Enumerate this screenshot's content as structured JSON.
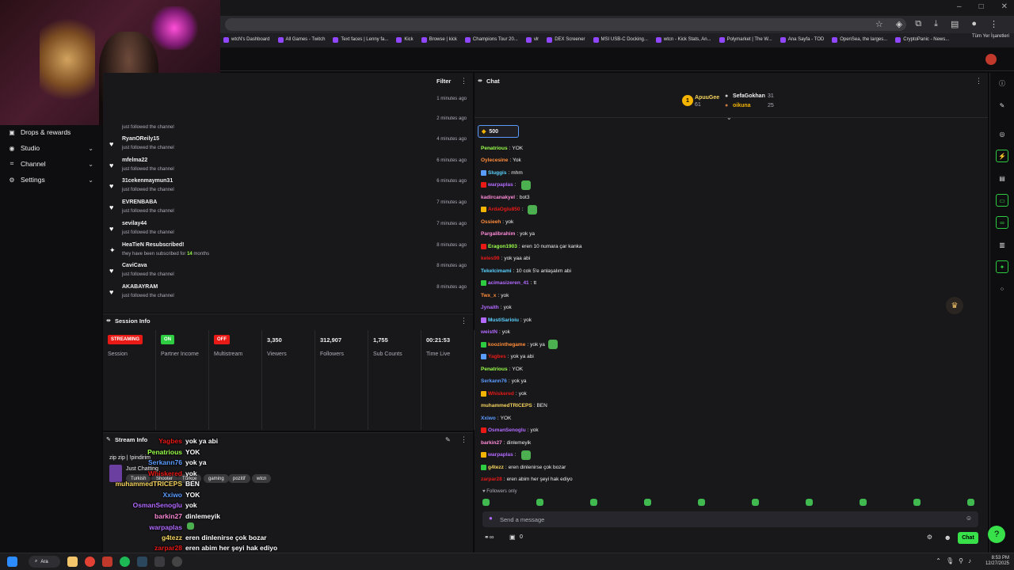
{
  "browser": {
    "bookmarks": [
      "wtcN's Dashboard",
      "All Games - Twitch",
      "Text faces | Lenny fa...",
      "Kick",
      "Browse | kick",
      "Champions Tour 20...",
      "vlr",
      "DEX Screener",
      "MSI USB-C Docking...",
      "wtcn - Kick Stats, An...",
      "Polymarket | The W...",
      "Ana Sayfa - TOD",
      "OpenSea, the larges...",
      "CryptoPanic - News..."
    ],
    "other_bookmarks": "Tüm Yer İşaretleri"
  },
  "sidebar": {
    "items": [
      {
        "label": "Drops & rewards",
        "icon": "gift-icon"
      },
      {
        "label": "Studio",
        "icon": "studio-icon"
      },
      {
        "label": "Channel",
        "icon": "channel-icon"
      },
      {
        "label": "Settings",
        "icon": "gear-icon"
      }
    ]
  },
  "activity": {
    "filter_label": "Filter",
    "first_time": "1 minutes ago",
    "partial": {
      "desc": "just followed the channel",
      "time": "2 minutes ago"
    },
    "events": [
      {
        "name": "RyanOReily15",
        "desc": "just followed the channel",
        "time": "4 minutes ago",
        "icon": "heart-icon"
      },
      {
        "name": "mfelma22",
        "desc": "just followed the channel",
        "time": "6 minutes ago",
        "icon": "heart-icon"
      },
      {
        "name": "31cekenmaymun31",
        "desc": "just followed the channel",
        "time": "6 minutes ago",
        "icon": "heart-icon"
      },
      {
        "name": "EVRENBABA",
        "desc": "just followed the channel",
        "time": "7 minutes ago",
        "icon": "heart-icon"
      },
      {
        "name": "sevilay44",
        "desc": "just followed the channel",
        "time": "7 minutes ago",
        "icon": "heart-icon"
      },
      {
        "name": "HeaTieN Resubscribed!",
        "desc_prefix": "they have been subscribed for ",
        "desc_num": "14",
        "desc_suffix": " months",
        "time": "8 minutes ago",
        "icon": "star-icon"
      },
      {
        "name": "CaviCava",
        "desc": "just followed the channel",
        "time": "8 minutes ago",
        "icon": "heart-icon"
      },
      {
        "name": "AKABAYRAM",
        "desc": "just followed the channel",
        "time": "8 minutes ago",
        "icon": "heart-icon"
      }
    ]
  },
  "session": {
    "title": "Session Info",
    "stats": [
      {
        "badge": "STREAMING",
        "badge_color": "#e91916",
        "label": "Session"
      },
      {
        "badge": "ON",
        "badge_color": "#2ecc40",
        "label": "Partner Income"
      },
      {
        "badge": "OFF",
        "badge_color": "#e91916",
        "label": "Multistream"
      },
      {
        "value": "3,350",
        "label": "Viewers"
      },
      {
        "value": "312,907",
        "label": "Followers"
      },
      {
        "value": "1,755",
        "label": "Sub Counts"
      },
      {
        "value": "00:21:53",
        "label": "Time Live"
      }
    ]
  },
  "stream_info": {
    "title": "Stream Info",
    "stream_title": "zip zip | !pindirim",
    "category": "Just Chatting",
    "tags": [
      "Turkish",
      "Shooter",
      "Türkçe",
      "gaming",
      "pozitif",
      "wtcn"
    ]
  },
  "overlay_chat": [
    {
      "user": "Yagbes",
      "msg": "yok ya abi",
      "color": "#e91916"
    },
    {
      "user": "Penatrious",
      "msg": "YOK",
      "color": "#9aff4a"
    },
    {
      "user": "Serkann76",
      "msg": "yok ya",
      "color": "#5b9cff"
    },
    {
      "user": "Whiskered",
      "msg": "yok",
      "color": "#e91916"
    },
    {
      "user": "muhammedTRICEPS",
      "msg": "BEN",
      "color": "#f4d35e"
    },
    {
      "user": "Xxiwo",
      "msg": "YOK",
      "color": "#5b9cff"
    },
    {
      "user": "OsmanSenoglu",
      "msg": "yok",
      "color": "#b36bff"
    },
    {
      "user": "barkin27",
      "msg": "dinlemeyik",
      "color": "#ff8ad8"
    },
    {
      "user": "warpaplas",
      "msg": "",
      "color": "#b36bff"
    },
    {
      "user": "g4tezz",
      "msg": "eren dinlenirse çok bozar",
      "color": "#f4d35e"
    },
    {
      "user": "zarpar28",
      "msg": "eren abim her şeyi hak ediyo",
      "color": "#e91916"
    }
  ],
  "chat": {
    "title": "Chat",
    "leaderboard": {
      "first": {
        "name": "ApuuGee",
        "count": "61"
      },
      "second": {
        "name": "SefaGokhan",
        "count": "31"
      },
      "third": {
        "name": "oikuna",
        "count": "25"
      }
    },
    "points": "500",
    "messages": [
      {
        "user": "Penatrious",
        "text": "YOK",
        "color": "#9aff4a"
      },
      {
        "user": "Oylecesine",
        "text": "Yok",
        "color": "#ff8c3a"
      },
      {
        "user": "Sluggis",
        "text": "mhm",
        "color": "#5bd2ff"
      },
      {
        "user": "warpaplas",
        "text": "",
        "color": "#b36bff",
        "emote": true
      },
      {
        "user": "kadircanakyel",
        "text": "bot3",
        "color": "#ff8ad8"
      },
      {
        "user": "ArdaOglu850",
        "text": "",
        "color": "#e91916",
        "emote": true
      },
      {
        "user": "Ossieeh",
        "text": "yok",
        "color": "#ff8c3a"
      },
      {
        "user": "Pargalibrahim",
        "text": "yok ya",
        "color": "#ff8ad8"
      },
      {
        "user": "Eragon1903",
        "text": "eren 10 numara çar kanka",
        "color": "#9aff4a"
      },
      {
        "user": "keles99",
        "text": "yok yaa abi",
        "color": "#e91916"
      },
      {
        "user": "Tekelcimami",
        "text": "10 cok 5'e anlaşalım abi",
        "color": "#5bd2ff"
      },
      {
        "user": "acimasizeren_41",
        "text": "tt",
        "color": "#b36bff"
      },
      {
        "user": "Twx_x",
        "text": "yok",
        "color": "#ff8c3a"
      },
      {
        "user": "Jynaith",
        "text": "yok",
        "color": "#b36bff"
      },
      {
        "user": "MustiSarioiu",
        "text": "yok",
        "color": "#5bd2ff"
      },
      {
        "user": "weistN",
        "text": "yok",
        "color": "#b36bff"
      },
      {
        "user": "koozinthegame",
        "text": "yok ya",
        "color": "#ff8c3a",
        "emote": true
      },
      {
        "user": "Yagbes",
        "text": "yok ya abi",
        "color": "#e91916"
      },
      {
        "user": "Penatrious",
        "text": "YOK",
        "color": "#9aff4a"
      },
      {
        "user": "Serkann76",
        "text": "yok ya",
        "color": "#5b9cff"
      },
      {
        "user": "Whiskered",
        "text": "yok",
        "color": "#e91916"
      },
      {
        "user": "muhammedTRICEPS",
        "text": "BEN",
        "color": "#f4d35e"
      },
      {
        "user": "Xxiwo",
        "text": "YOK",
        "color": "#5b9cff"
      },
      {
        "user": "OsmanSenoglu",
        "text": "yok",
        "color": "#b36bff"
      },
      {
        "user": "barkin27",
        "text": "dinlemeyik",
        "color": "#ff8ad8"
      },
      {
        "user": "warpaplas",
        "text": "",
        "color": "#b36bff",
        "emote": true
      },
      {
        "user": "g4tezz",
        "text": "eren dinlenirse çok bozar",
        "color": "#f4d35e"
      },
      {
        "user": "zarpar28",
        "text": "eren abim her şeyi hak ediyo",
        "color": "#e91916"
      }
    ],
    "followers_only": "Followers only",
    "input_placeholder": "Send a message",
    "footer_count": "0",
    "send_label": "Chat"
  },
  "taskbar": {
    "search_label": "Ara",
    "time": "8:53 PM",
    "date": "12/27/2025"
  }
}
